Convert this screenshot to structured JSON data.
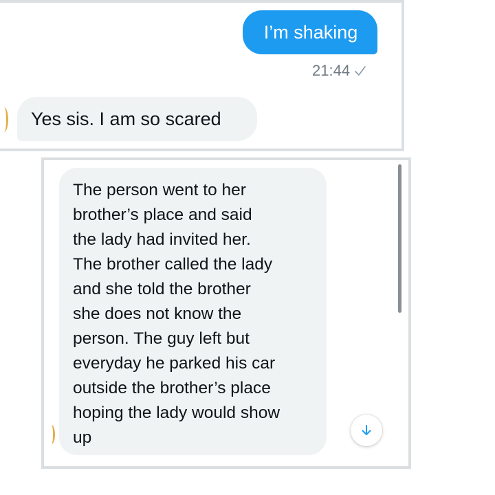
{
  "conversation_top": {
    "sent_message": {
      "text": "I’m shaking",
      "time": "21:44",
      "status_icon": "check-icon",
      "bubble_color": "#1d9bf0"
    },
    "received_message": {
      "text": "Yes sis. I am so scared",
      "bubble_color": "#eff3f4"
    }
  },
  "conversation_bottom": {
    "received_message": {
      "lines": [
        "The person went to her",
        "brother’s place and said",
        "the lady had invited her.",
        "The brother called the lady",
        "and she told the brother",
        "she does not know the",
        "person. The guy left but",
        "everyday he parked his car",
        "outside the brother’s place",
        "hoping the lady would show",
        "up"
      ],
      "bubble_color": "#eff3f4"
    },
    "scroll_down_button": {
      "icon": "arrow-down-icon",
      "icon_color": "#1d9bf0"
    }
  }
}
